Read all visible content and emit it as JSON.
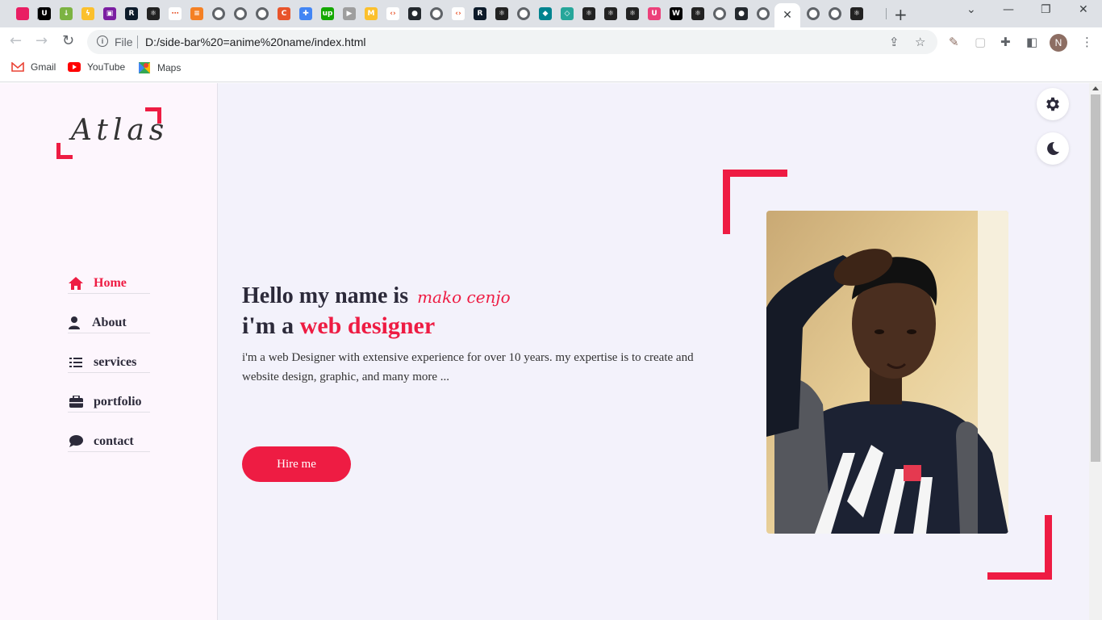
{
  "browser": {
    "tab_favicons": [
      {
        "icon": "pink-square-icon",
        "color": "#e91e63",
        "glyph": ""
      },
      {
        "icon": "unicorn-icon",
        "color": "#000000",
        "glyph": "U"
      },
      {
        "icon": "download-icon",
        "color": "#7cb342",
        "glyph": "↓"
      },
      {
        "icon": "lightning-icon",
        "color": "#fbc02d",
        "glyph": "ϟ"
      },
      {
        "icon": "form-icon",
        "color": "#7b1fa2",
        "glyph": "▣"
      },
      {
        "icon": "rb-icon",
        "color": "#0d1b2a",
        "glyph": "R"
      },
      {
        "icon": "react-icon",
        "color": "#222222",
        "glyph": "⚛"
      },
      {
        "icon": "dots-icon",
        "color": "#ffffff",
        "glyph": "⋯"
      },
      {
        "icon": "stack-icon",
        "color": "#f48024",
        "glyph": "≡"
      },
      {
        "icon": "globe-icon",
        "color": "#5f6368",
        "glyph": "●"
      },
      {
        "icon": "globe-icon",
        "color": "#5f6368",
        "glyph": "●"
      },
      {
        "icon": "globe-icon",
        "color": "#5f6368",
        "glyph": "●"
      },
      {
        "icon": "codepen-icon",
        "color": "#e8542b",
        "glyph": "C"
      },
      {
        "icon": "puzzle-icon",
        "color": "#4285f4",
        "glyph": "✚"
      },
      {
        "icon": "upwork-icon",
        "color": "#14a800",
        "glyph": "up"
      },
      {
        "icon": "video-icon",
        "color": "#9e9e9e",
        "glyph": "▶"
      },
      {
        "icon": "mb-icon",
        "color": "#fbc02d",
        "glyph": "M"
      },
      {
        "icon": "code-icon",
        "color": "#ffffff",
        "glyph": "‹›"
      },
      {
        "icon": "github-icon",
        "color": "#24292e",
        "glyph": "●"
      },
      {
        "icon": "globe-icon",
        "color": "#5f6368",
        "glyph": "●"
      },
      {
        "icon": "code-icon",
        "color": "#ffffff",
        "glyph": "‹›"
      },
      {
        "icon": "rb-icon",
        "color": "#0d1b2a",
        "glyph": "R"
      },
      {
        "icon": "react-icon",
        "color": "#222222",
        "glyph": "⚛"
      },
      {
        "icon": "globe-icon",
        "color": "#5f6368",
        "glyph": "●"
      },
      {
        "icon": "diamond-icon",
        "color": "#00838f",
        "glyph": "◆"
      },
      {
        "icon": "diamond-icon",
        "color": "#26a69a",
        "glyph": "◇"
      },
      {
        "icon": "react-icon",
        "color": "#222222",
        "glyph": "⚛"
      },
      {
        "icon": "react-icon",
        "color": "#222222",
        "glyph": "⚛"
      },
      {
        "icon": "react-icon",
        "color": "#222222",
        "glyph": "⚛"
      },
      {
        "icon": "u-icon",
        "color": "#ec407a",
        "glyph": "U"
      },
      {
        "icon": "wk-icon",
        "color": "#000000",
        "glyph": "W"
      },
      {
        "icon": "react-icon",
        "color": "#222222",
        "glyph": "⚛"
      },
      {
        "icon": "globe-icon",
        "color": "#5f6368",
        "glyph": "●"
      },
      {
        "icon": "github-icon",
        "color": "#24292e",
        "glyph": "●"
      },
      {
        "icon": "globe-icon",
        "color": "#5f6368",
        "glyph": "●"
      }
    ],
    "tab_favicons_after": [
      {
        "icon": "globe-icon",
        "color": "#5f6368",
        "glyph": "●"
      },
      {
        "icon": "globe-icon",
        "color": "#5f6368",
        "glyph": "●"
      },
      {
        "icon": "react-icon",
        "color": "#222222",
        "glyph": "⚛"
      }
    ],
    "active_tab_close": "✕",
    "new_tab": "+",
    "window_controls": {
      "dropdown": "⌄",
      "minimize": "—",
      "restore": "❐",
      "close": "✕"
    },
    "nav": {
      "back": "←",
      "forward": "→",
      "reload": "↻"
    },
    "omnibox": {
      "info": "i",
      "scheme_label": "File",
      "url": "D:/side-bar%20=anime%20name/index.html"
    },
    "avatar_letter": "N",
    "bookmarks": [
      {
        "label": "Gmail",
        "icon": "gmail-icon"
      },
      {
        "label": "YouTube",
        "icon": "youtube-icon"
      },
      {
        "label": "Maps",
        "icon": "maps-icon"
      }
    ]
  },
  "site": {
    "logo": "Atlas",
    "nav": [
      {
        "label": "Home",
        "icon": "home-icon",
        "active": true
      },
      {
        "label": "About",
        "icon": "user-icon",
        "active": false
      },
      {
        "label": "services",
        "icon": "list-icon",
        "active": false
      },
      {
        "label": "portfolio",
        "icon": "briefcase-icon",
        "active": false
      },
      {
        "label": "contact",
        "icon": "comment-icon",
        "active": false
      }
    ],
    "hero": {
      "hello": "Hello my name is",
      "name": "mako cenjo",
      "role_prefix": "i'm a",
      "role_highlight": "web designer",
      "description": "i'm a web Designer with extensive experience for over 10 years. my expertise is to create and website design, graphic, and many more ...",
      "cta": "Hire me"
    },
    "colors": {
      "accent": "#ee1c43",
      "text": "#2c2a3a",
      "page_bg": "#f3f2fb",
      "sidebar_bg": "#fdf6fd"
    }
  }
}
